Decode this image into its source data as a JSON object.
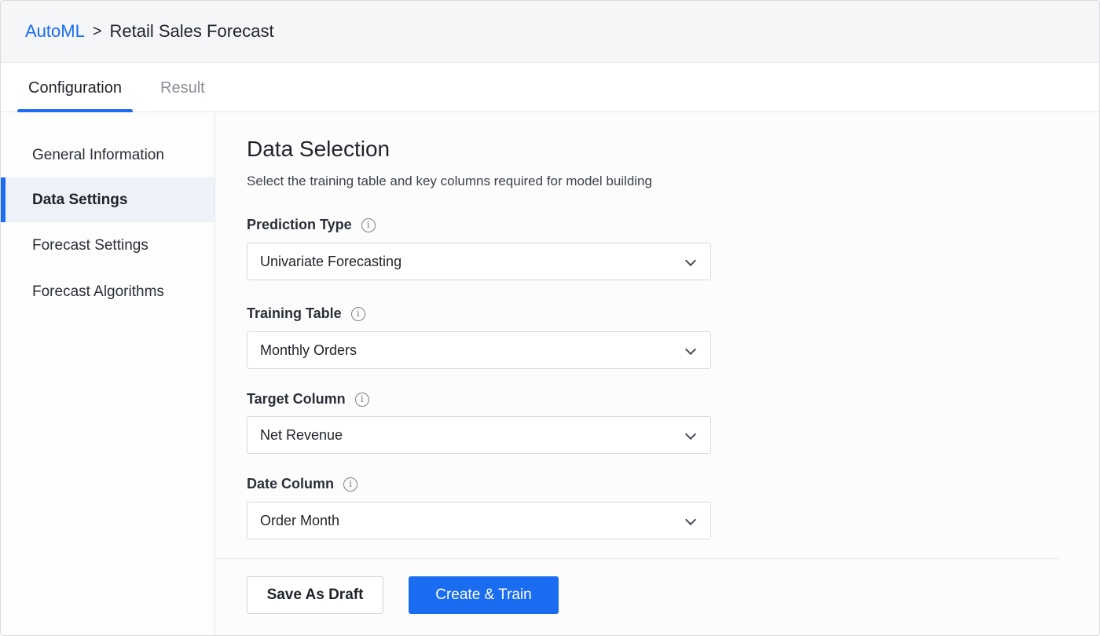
{
  "breadcrumb": {
    "root": "AutoML",
    "separator": ">",
    "current": "Retail Sales Forecast"
  },
  "tabs": [
    {
      "label": "Configuration",
      "active": true
    },
    {
      "label": "Result",
      "active": false
    }
  ],
  "sidebar": {
    "items": [
      {
        "label": "General Information",
        "active": false
      },
      {
        "label": "Data Settings",
        "active": true
      },
      {
        "label": "Forecast Settings",
        "active": false
      },
      {
        "label": "Forecast Algorithms",
        "active": false
      }
    ]
  },
  "main": {
    "title": "Data Selection",
    "subtitle": "Select the training table and key columns required for model building",
    "fields": [
      {
        "label": "Prediction Type",
        "value": "Univariate Forecasting",
        "info_icon": "info-icon"
      },
      {
        "label": "Training Table",
        "value": "Monthly Orders",
        "info_icon": "info-icon"
      },
      {
        "label": "Target Column",
        "value": "Net Revenue",
        "info_icon": "info-icon"
      },
      {
        "label": "Date Column",
        "value": "Order Month",
        "info_icon": "info-icon"
      }
    ]
  },
  "actions": {
    "save_draft": "Save As Draft",
    "create_train": "Create & Train"
  },
  "colors": {
    "accent": "#1a6cf0"
  }
}
